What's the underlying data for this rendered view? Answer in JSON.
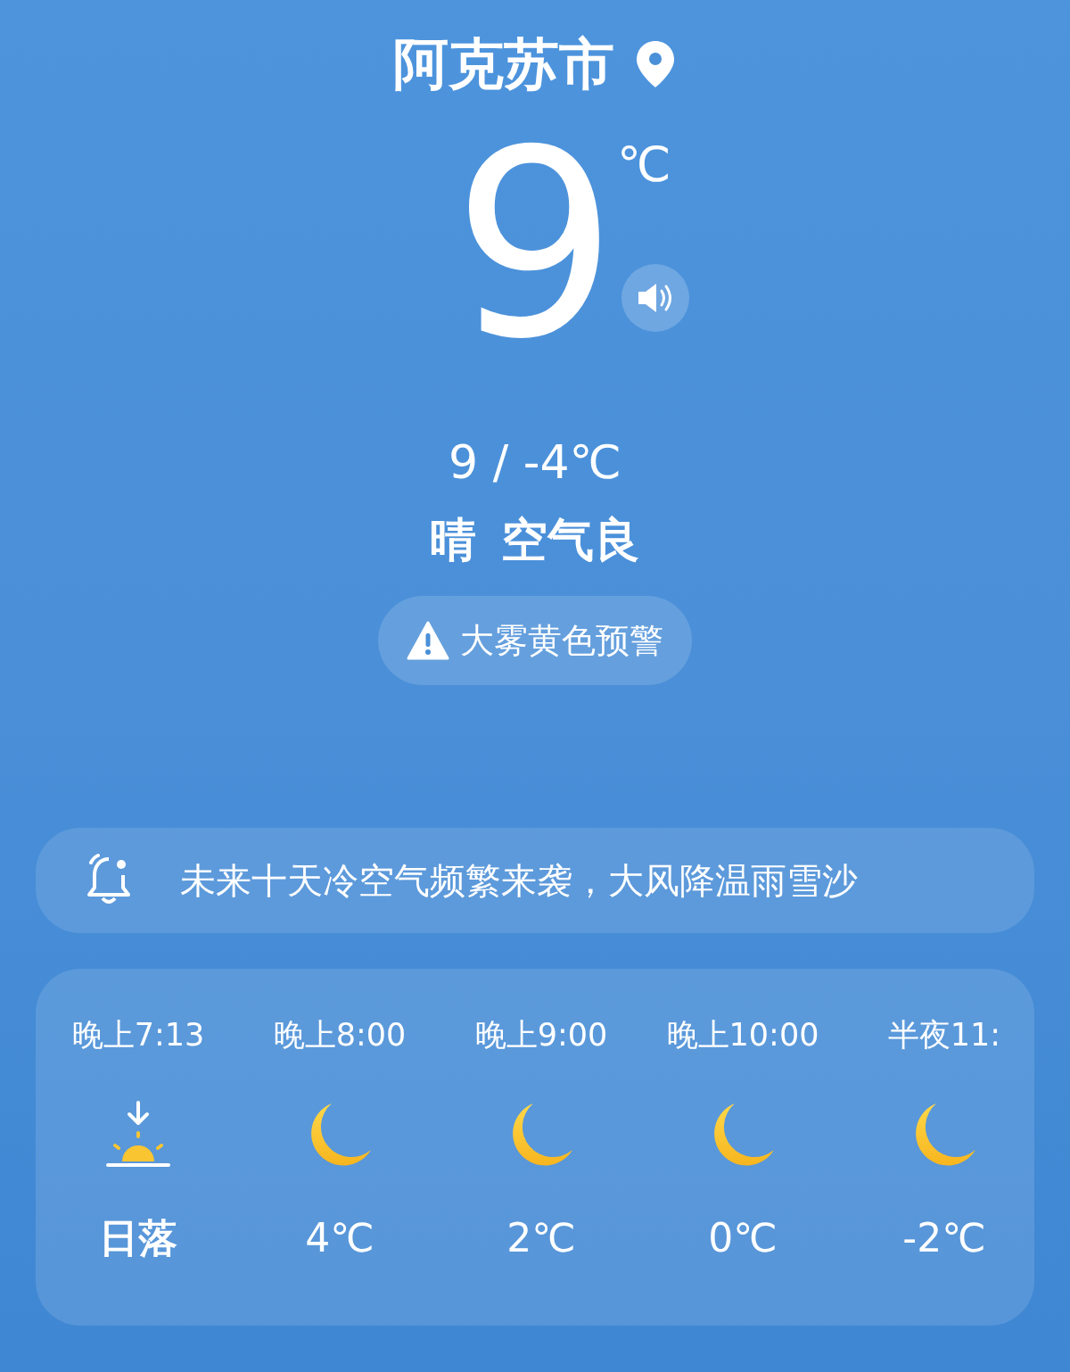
{
  "location": {
    "city": "阿克苏市"
  },
  "current": {
    "temperature": "9",
    "unit": "℃",
    "range": "9 / -4℃",
    "condition": "晴",
    "air_quality": "空气良"
  },
  "warning": {
    "text": "大雾黄色预警"
  },
  "notice": {
    "text": "未来十天冷空气频繁来袭，大风降温雨雪沙"
  },
  "hourly": [
    {
      "time": "晚上7:13",
      "kind": "sunset",
      "label": "日落"
    },
    {
      "time": "晚上8:00",
      "kind": "moon",
      "label": "4℃"
    },
    {
      "time": "晚上9:00",
      "kind": "moon",
      "label": "2℃"
    },
    {
      "time": "晚上10:00",
      "kind": "moon",
      "label": "0℃"
    },
    {
      "time": "半夜11:",
      "kind": "moon",
      "label": "-2℃"
    }
  ]
}
